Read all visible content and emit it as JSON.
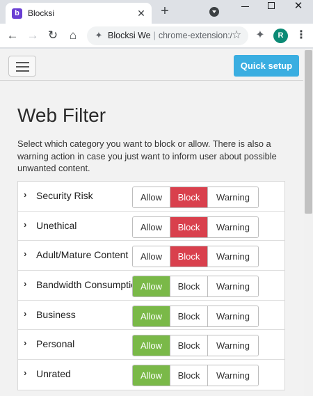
{
  "browser": {
    "tab_title": "Blocksi",
    "tab_favicon_letter": "b",
    "tab_close": "✕",
    "new_tab": "+",
    "win_close": "✕",
    "address": {
      "site_name": "Blocksi We",
      "separator": "|",
      "url": "chrome-extension://"
    },
    "profile_initial": "R",
    "icons": {
      "back": "←",
      "forward": "→",
      "reload": "↻",
      "home": "⌂",
      "extension": "✦",
      "star": "☆",
      "menu": "⋮"
    }
  },
  "header": {
    "quick_setup_label": "Quick setup"
  },
  "page": {
    "title": "Web Filter",
    "description": "Select which category you want to block or allow. There is also a warning action in case you just want to inform user about possible unwanted content."
  },
  "filter": {
    "action_labels": {
      "allow": "Allow",
      "block": "Block",
      "warning": "Warning"
    },
    "rows": [
      {
        "label": "Security Risk",
        "selected": "block"
      },
      {
        "label": "Unethical",
        "selected": "block"
      },
      {
        "label": "Adult/Mature Content",
        "selected": "block"
      },
      {
        "label": "Bandwidth Consumption",
        "selected": "allow"
      },
      {
        "label": "Business",
        "selected": "allow"
      },
      {
        "label": "Personal",
        "selected": "allow"
      },
      {
        "label": "Unrated",
        "selected": "allow"
      }
    ]
  },
  "colors": {
    "block_active": "#d9404d",
    "allow_active": "#7ab948",
    "quick_setup": "#3aaee1"
  }
}
